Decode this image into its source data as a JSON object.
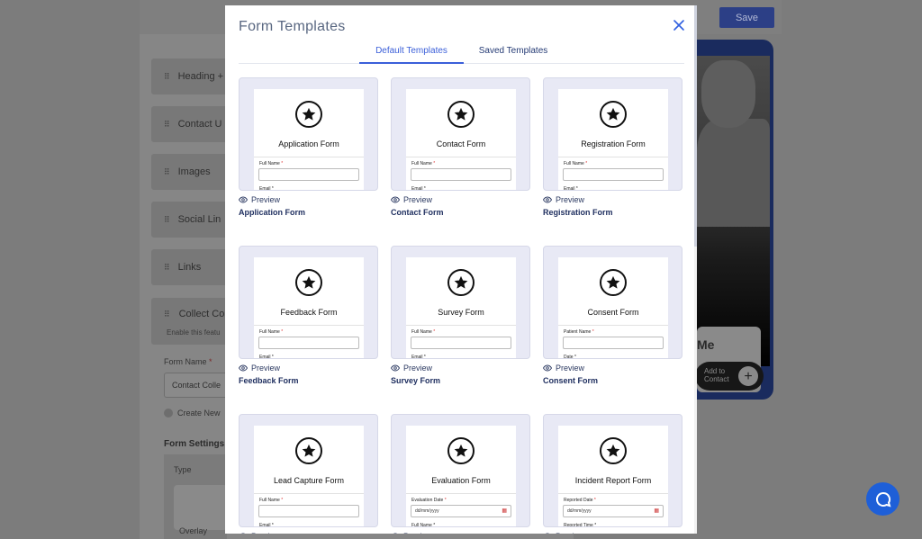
{
  "background": {
    "save_label": "Save",
    "sections": [
      "Heading +",
      "Contact U",
      "Images",
      "Social Lin",
      "Links"
    ],
    "collect_title": "Collect Co",
    "collect_sub": "Enable this featu",
    "form_name_label": "Form Name",
    "form_name_required": "*",
    "form_name_value": "Contact Colle",
    "create_new_label": "Create New",
    "form_settings_label": "Form Settings",
    "type_label": "Type",
    "overlay_label": "Overlay",
    "preview_name": "Me",
    "add_to_contact": "Add to\nContact"
  },
  "modal": {
    "title": "Form Templates",
    "tabs": [
      {
        "label": "Default Templates",
        "active": true
      },
      {
        "label": "Saved Templates",
        "active": false
      }
    ],
    "preview_label": "Preview",
    "templates": [
      {
        "name": "Application Form",
        "thumb_title": "Application Form",
        "field1": "Full Name",
        "field2": "Email",
        "date": false
      },
      {
        "name": "Contact Form",
        "thumb_title": "Contact Form",
        "field1": "Full Name",
        "field2": "Email",
        "date": false
      },
      {
        "name": "Registration Form",
        "thumb_title": "Registration Form",
        "field1": "Full Name",
        "field2": "Email",
        "date": false
      },
      {
        "name": "Feedback Form",
        "thumb_title": "Feedback Form",
        "field1": "Full Name",
        "field2": "Email",
        "date": false
      },
      {
        "name": "Survey Form",
        "thumb_title": "Survey Form",
        "field1": "Full Name",
        "field2": "Email",
        "date": false
      },
      {
        "name": "Consent Form",
        "thumb_title": "Consent Form",
        "field1": "Patient Name",
        "field2": "Date",
        "date": false
      },
      {
        "name": "Lead Capture Form",
        "thumb_title": "Lead Capture Form",
        "field1": "Full Name",
        "field2": "Email",
        "date": false
      },
      {
        "name": "Evaluation Form",
        "thumb_title": "Evaluation Form",
        "field1": "Evaluation Date",
        "field2": "Full Name",
        "date": true,
        "date_placeholder": "dd/mm/yyyy"
      },
      {
        "name": "Incident Report Form",
        "thumb_title": "Incident Report Form",
        "field1": "Reported Date",
        "field2": "Reported Time",
        "date": true,
        "date_placeholder": "dd/mm/yyyy"
      }
    ]
  },
  "colors": {
    "accent": "#3b5fd9",
    "title": "#596781",
    "thumb_bg": "#e8e9f5",
    "help_bubble": "#1e5fd8"
  },
  "icons": {
    "close": "close-icon",
    "preview": "eye-icon",
    "template": "star-icon",
    "help": "chat-icon"
  }
}
